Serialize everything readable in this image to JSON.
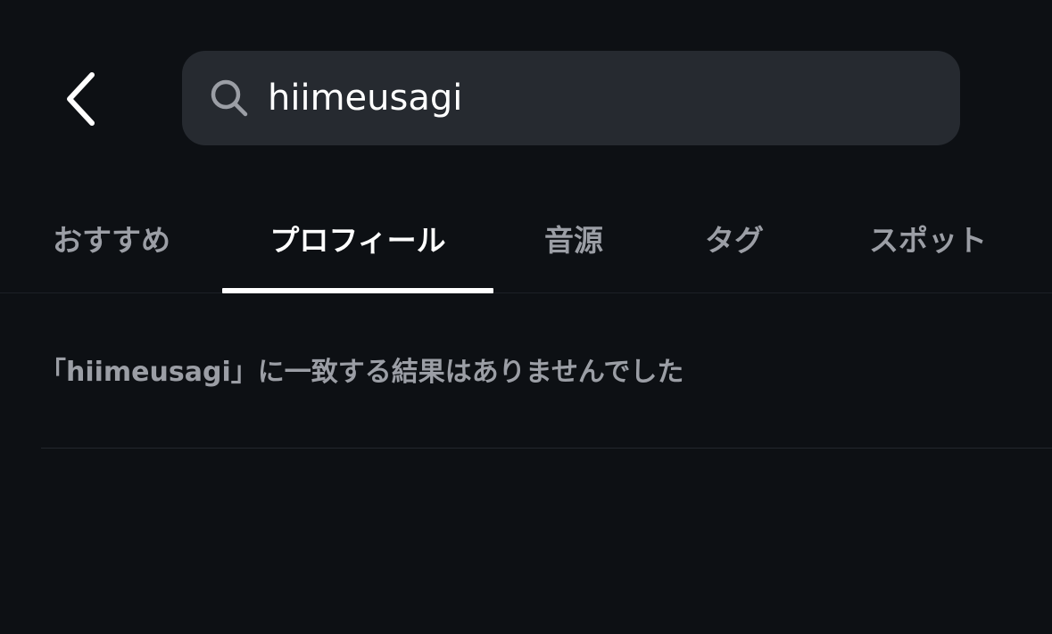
{
  "header": {
    "back_icon": "chevron-left-icon",
    "search": {
      "icon": "search-icon",
      "value": "hiimeusagi"
    }
  },
  "tabs": [
    {
      "label": "おすすめ",
      "active": false
    },
    {
      "label": "プロフィール",
      "active": true
    },
    {
      "label": "音源",
      "active": false
    },
    {
      "label": "タグ",
      "active": false
    },
    {
      "label": "スポット",
      "active": false
    }
  ],
  "results": {
    "empty_message": "「hiimeusagi」に一致する結果はありませんでした"
  },
  "colors": {
    "background": "#0d1014",
    "search_bg": "#262a30",
    "active_text": "#ffffff",
    "inactive_text": "#9b9ea5"
  }
}
